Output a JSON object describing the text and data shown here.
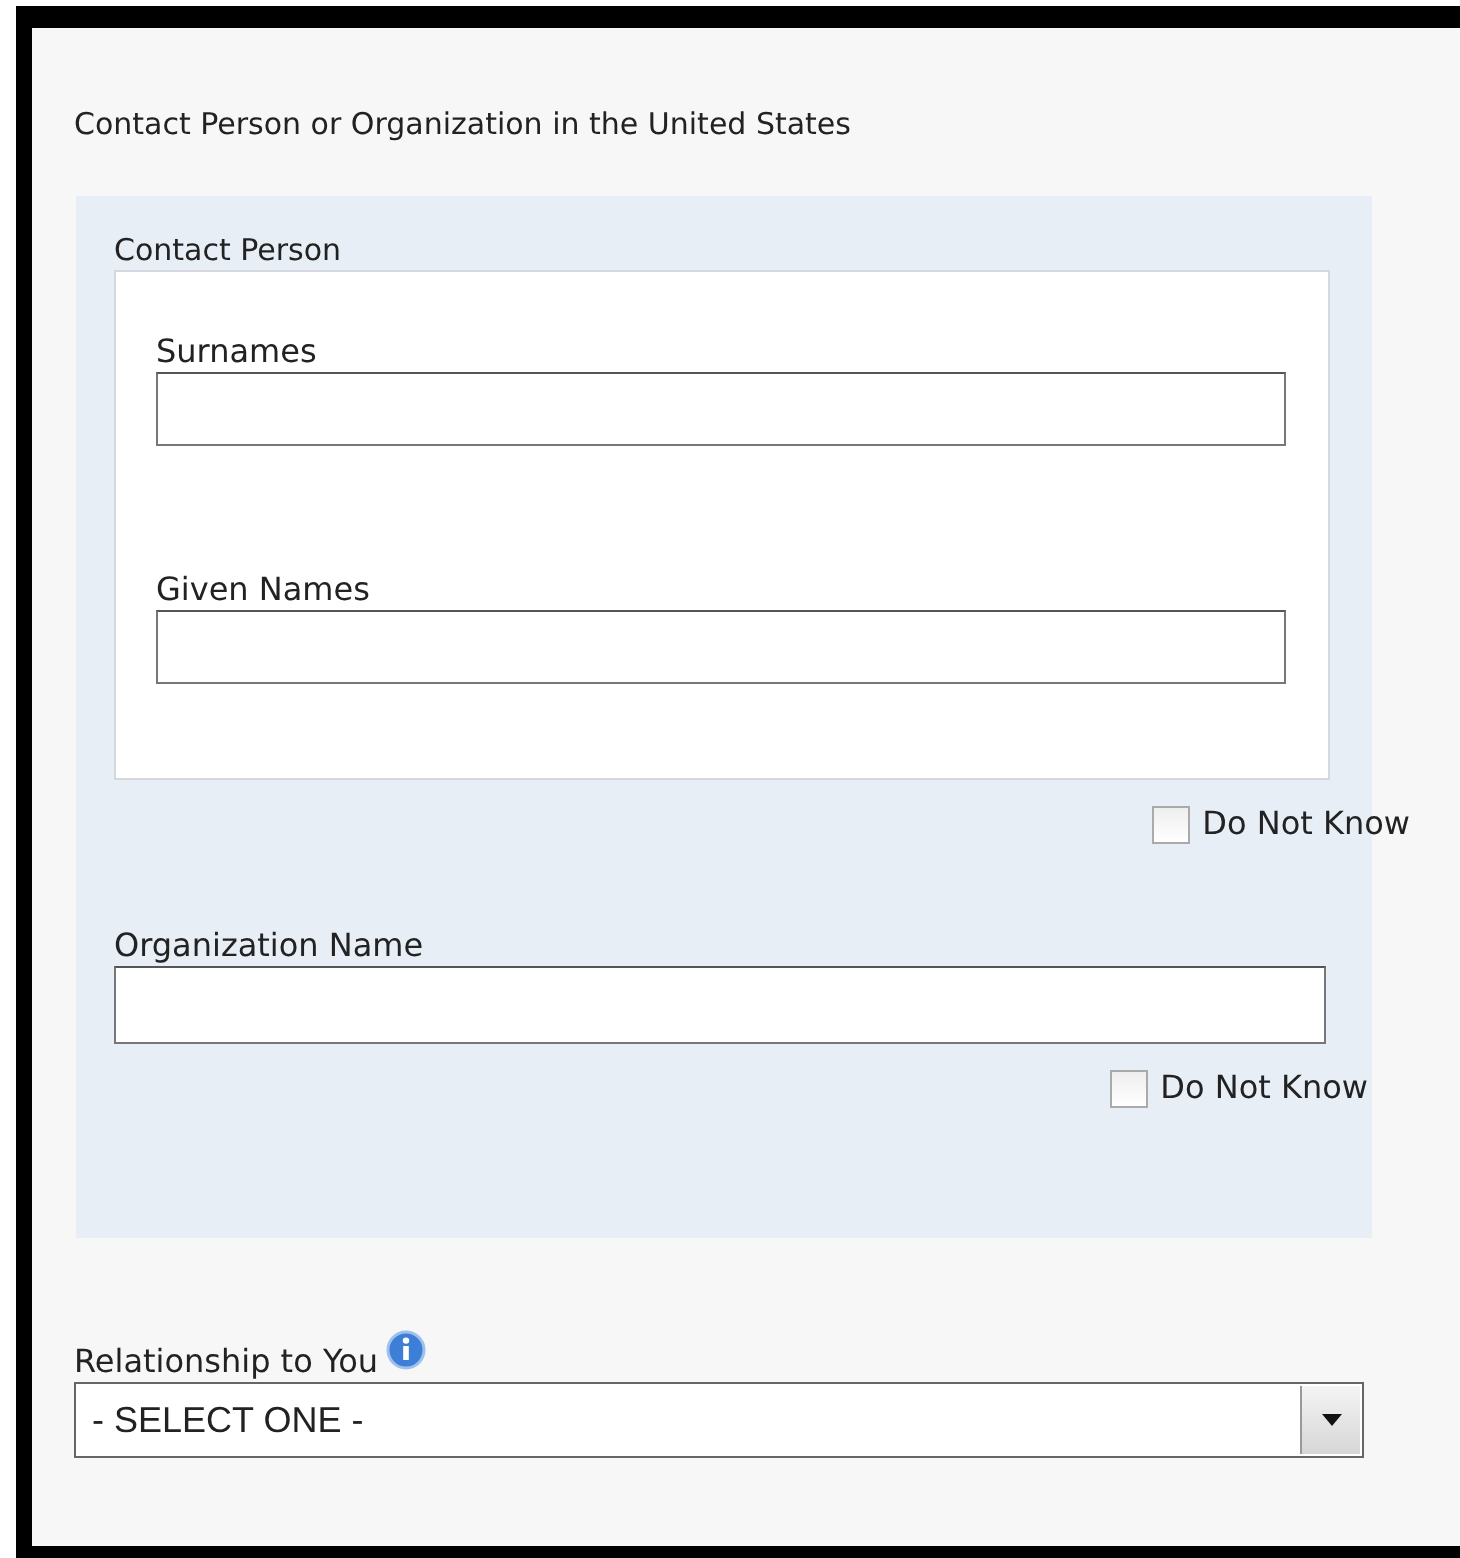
{
  "section": {
    "title": "Contact Person or Organization in the United States"
  },
  "contact_person": {
    "title": "Contact Person",
    "fields": [
      {
        "label": "Surnames"
      },
      {
        "label": "Given Names"
      }
    ],
    "do_not_know": {
      "label": "Do Not Know",
      "checked": false
    }
  },
  "organization": {
    "label": "Organization Name",
    "do_not_know": {
      "label": "Do Not Know",
      "checked": false
    }
  },
  "relationship": {
    "label": "Relationship to You",
    "value": "- SELECT ONE -"
  }
}
